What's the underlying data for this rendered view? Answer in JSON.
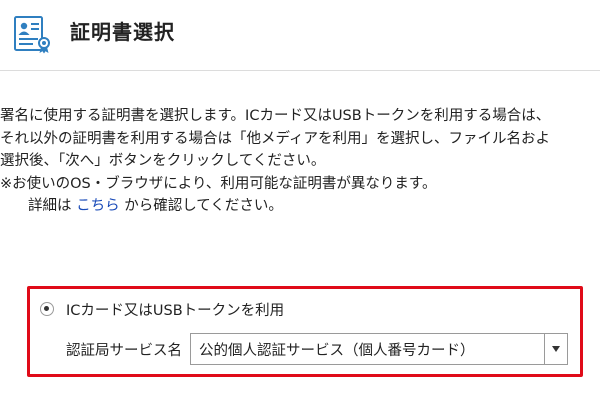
{
  "header": {
    "title": "証明書選択",
    "icon": "certificate-icon"
  },
  "description": {
    "line1": "署名に使用する証明書を選択します。ICカード又はUSBトークンを利用する場合は、",
    "line2": "それ以外の証明書を利用する場合は「他メディアを利用」を選択し、ファイル名およ",
    "line3": "選択後、「次へ」ボタンをクリックしてください。",
    "line4": "※お使いのOS・ブラウザにより、利用可能な証明書が異なります。",
    "detail_prefix": "詳細は ",
    "detail_link": "こちら",
    "detail_suffix": " から確認してください。"
  },
  "option": {
    "radio_label": "ICカード又はUSBトークンを利用",
    "radio_selected": true,
    "service_label": "認証局サービス名",
    "service_value": "公的個人認証サービス（個人番号カード）"
  },
  "colors": {
    "highlight_border": "#e00b18",
    "link": "#1a4bb8",
    "icon_blue": "#2f7fc0"
  }
}
